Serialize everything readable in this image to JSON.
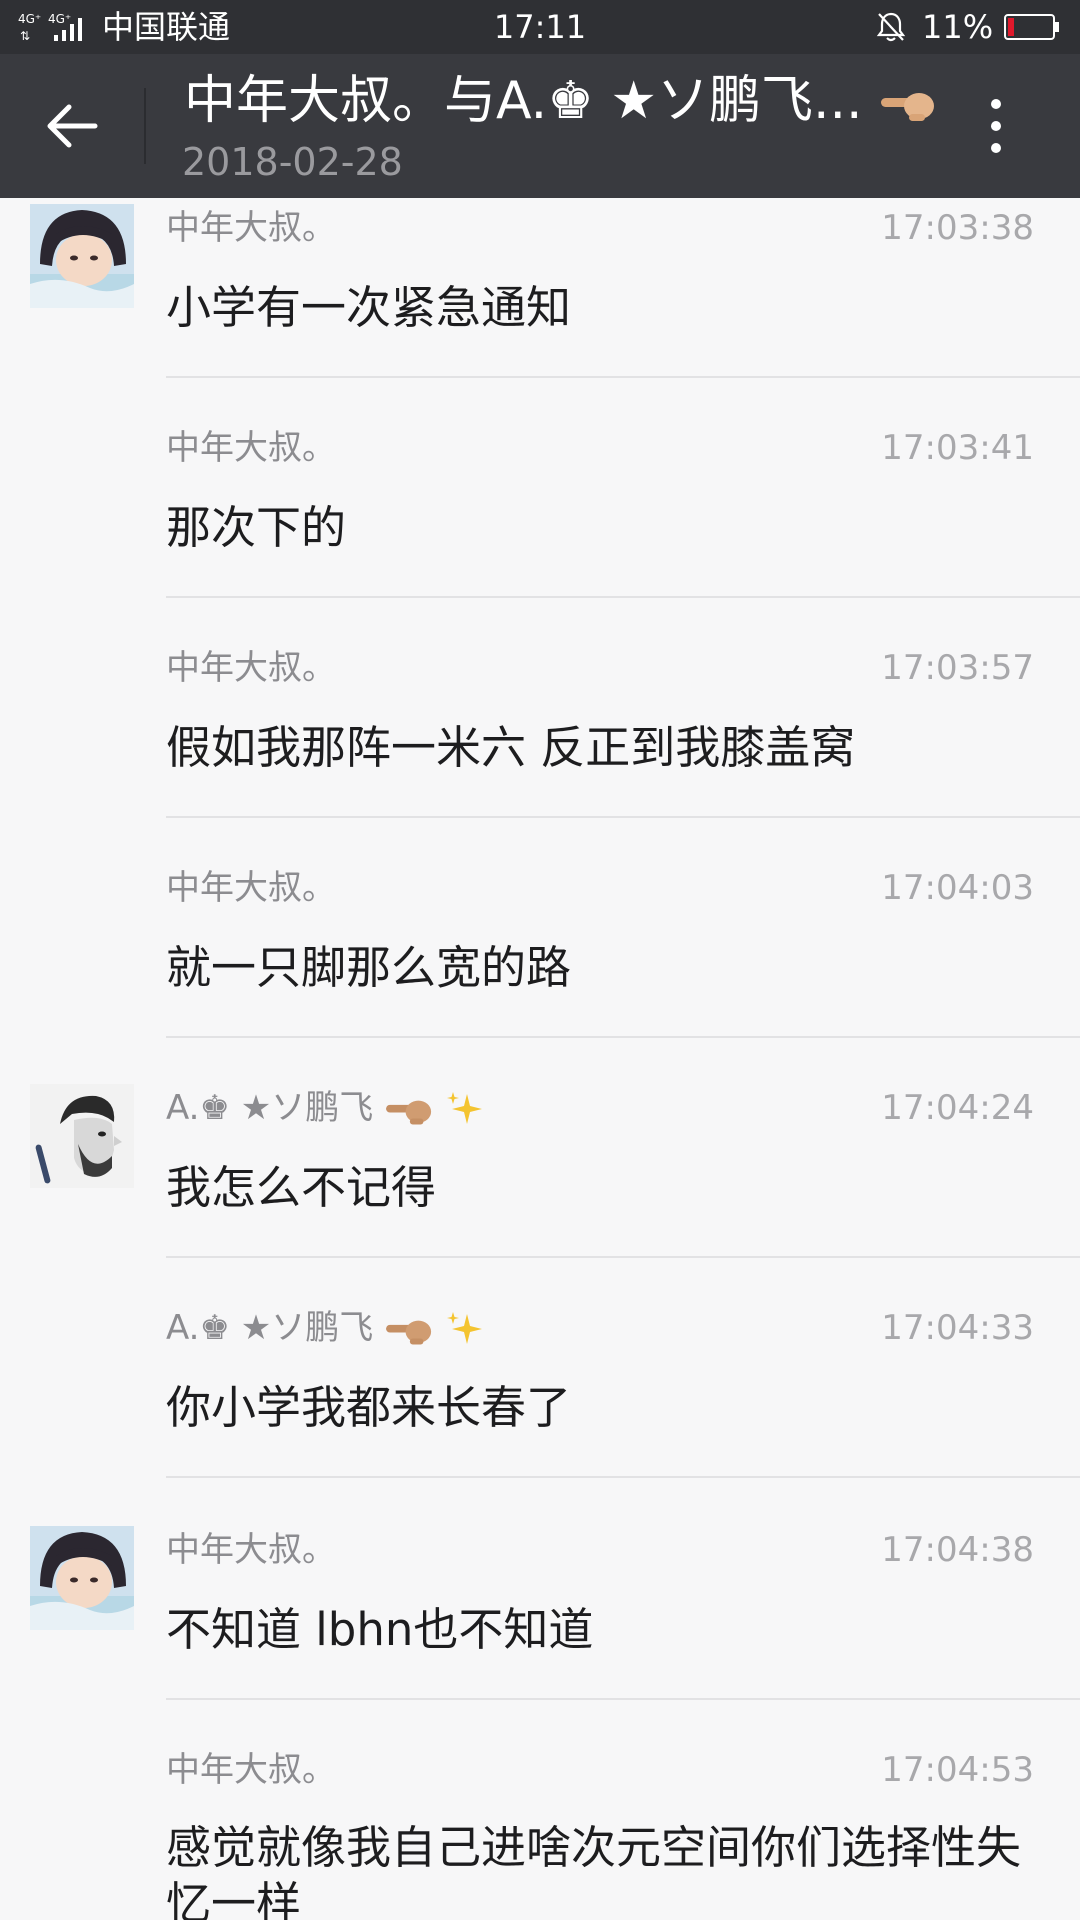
{
  "status_bar": {
    "network": "4G⁺ 4G⁺",
    "carrier": "中国联通",
    "time": "17:11",
    "battery_percent": "11%",
    "icons": [
      "signal-icon",
      "bell-muted-icon",
      "battery-low-icon"
    ]
  },
  "header": {
    "title": "中年大叔。与A.♚ ★ソ鹏飞...",
    "date": "2018-02-28",
    "icons": [
      "back-arrow-icon",
      "pointing-hand-emoji",
      "more-vertical-icon"
    ]
  },
  "messages": [
    {
      "sender": "中年大叔。",
      "time": "17:03:38",
      "text": "小学有一次紧急通知",
      "avatar": "girl-avatar"
    },
    {
      "sender": "中年大叔。",
      "time": "17:03:41",
      "text": "那次下的"
    },
    {
      "sender": "中年大叔。",
      "time": "17:03:57",
      "text": "假如我那阵一米六 反正到我膝盖窝"
    },
    {
      "sender": "中年大叔。",
      "time": "17:04:03",
      "text": "就一只脚那么宽的路"
    },
    {
      "sender": "A.♚ ★ソ鹏飞",
      "time": "17:04:24",
      "text": "我怎么不记得",
      "avatar": "man-avatar"
    },
    {
      "sender": "A.♚ ★ソ鹏飞",
      "time": "17:04:33",
      "text": "你小学我都来长春了"
    },
    {
      "sender": "中年大叔。",
      "time": "17:04:38",
      "text": "不知道 lbhn也不知道",
      "avatar": "girl-avatar"
    },
    {
      "sender": "中年大叔。",
      "time": "17:04:53",
      "text": "感觉就像我自己进啥次元空间你们选择性失忆一样"
    }
  ],
  "colors": {
    "status_bar_bg": "#2f3034",
    "title_bar_bg": "#393a3f",
    "list_bg": "#f7f7f8",
    "battery_low": "#e0192c"
  }
}
